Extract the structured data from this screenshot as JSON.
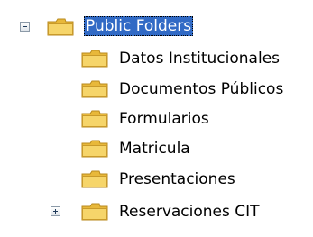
{
  "tree": {
    "root": {
      "label": "Public Folders",
      "icon": "folder-icon",
      "expander": "minus",
      "selected": true
    },
    "children": [
      {
        "label": "Datos Institucionales",
        "icon": "folder-icon"
      },
      {
        "label": "Documentos Públicos",
        "icon": "folder-icon"
      },
      {
        "label": "Formularios",
        "icon": "folder-icon"
      },
      {
        "label": "Matricula",
        "icon": "folder-icon"
      },
      {
        "label": "Presentaciones",
        "icon": "folder-icon"
      },
      {
        "label": "Reservaciones CIT",
        "icon": "folder-icon",
        "expander": "plus"
      }
    ]
  },
  "colors": {
    "selection_bg": "#316ac5",
    "selection_text": "#ffffff",
    "folder_fill": "#f6d56a",
    "folder_tab": "#e8b83a",
    "expander_border": "#8c9aa8"
  }
}
